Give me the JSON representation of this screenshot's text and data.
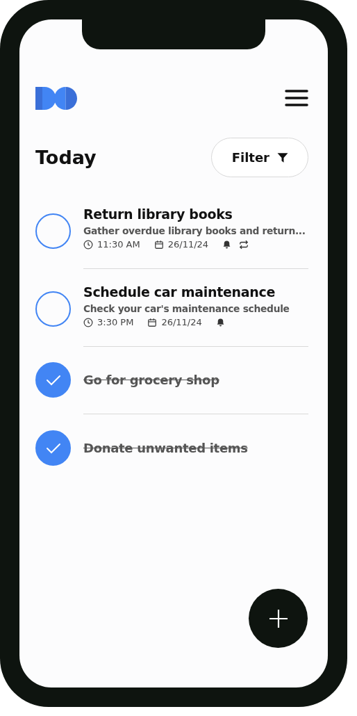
{
  "header": {
    "title": "Today",
    "filter_button": "Filter"
  },
  "tasks": [
    {
      "title": "Return library books",
      "description": "Gather overdue library books and return...",
      "time": "11:30 AM",
      "date": "26/11/24",
      "reminder": true,
      "repeat": true,
      "done": false
    },
    {
      "title": "Schedule car maintenance",
      "description": "Check your car's maintenance schedule",
      "time": "3:30 PM",
      "date": "26/11/24",
      "reminder": true,
      "repeat": false,
      "done": false
    },
    {
      "title": "Go for grocery shop",
      "done": true
    },
    {
      "title": "Donate unwanted items",
      "done": true
    }
  ]
}
